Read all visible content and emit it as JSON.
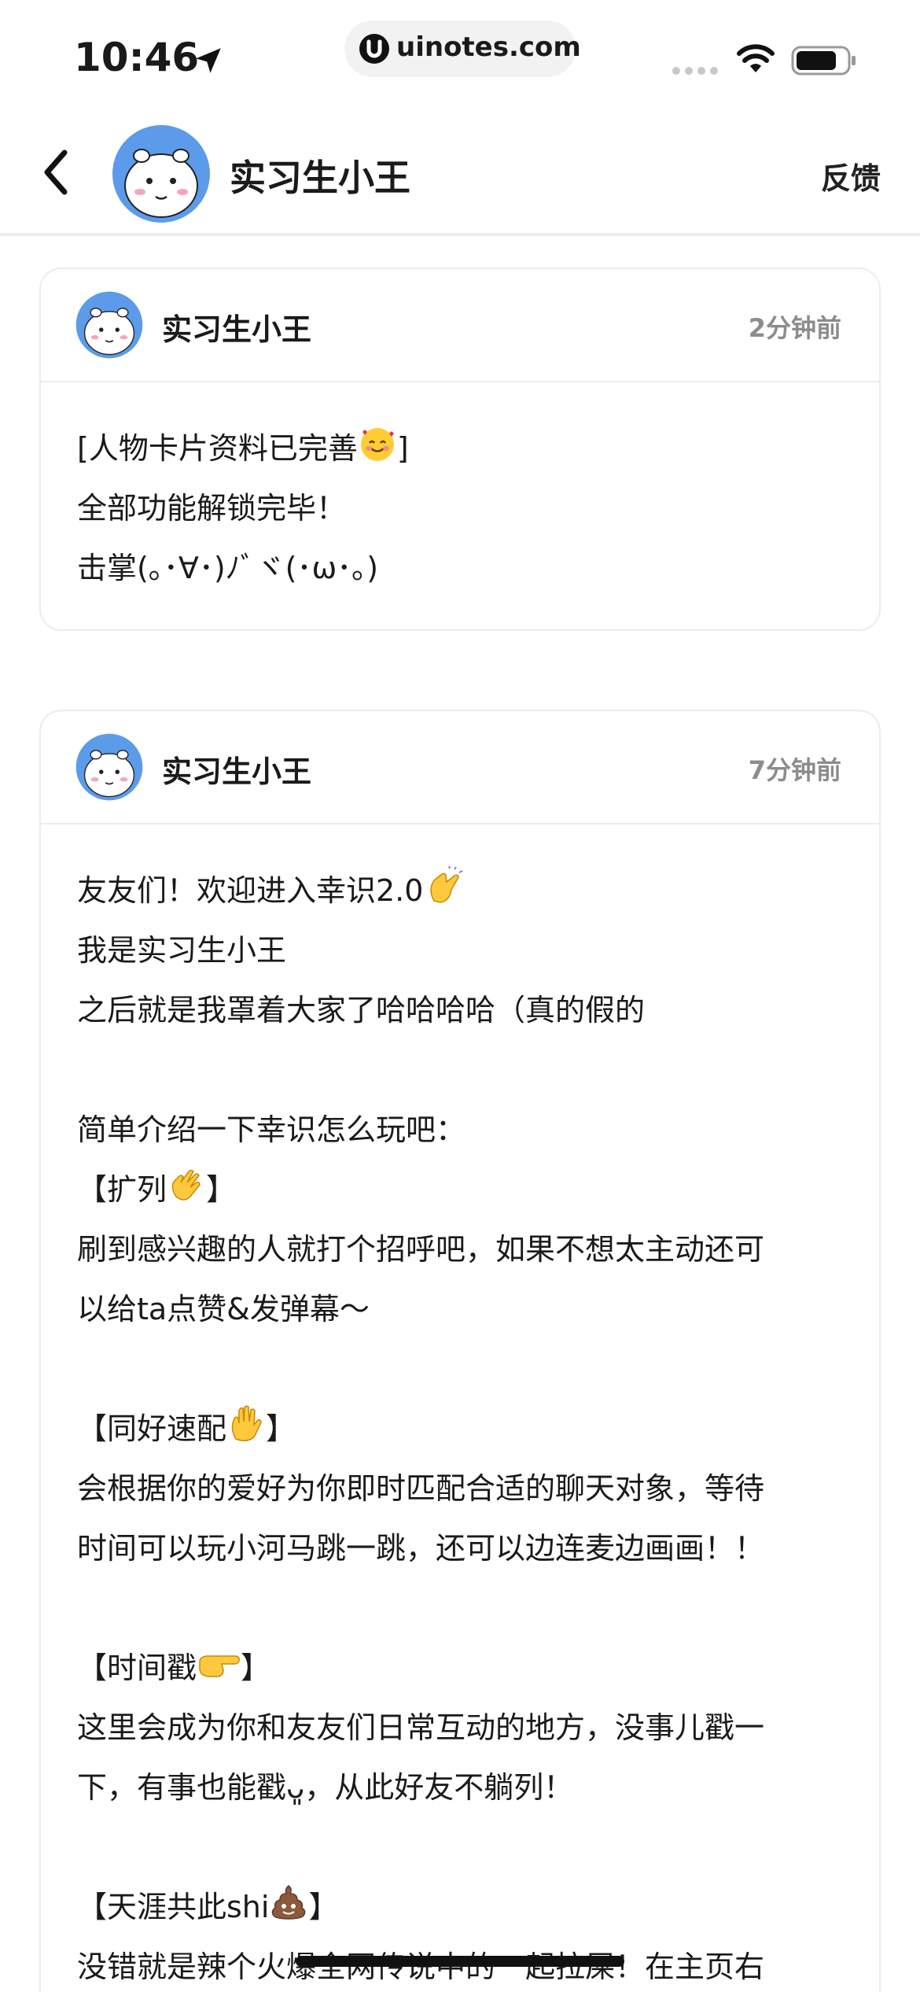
{
  "status_bar": {
    "time": "10:46",
    "url": "uinotes.com"
  },
  "nav": {
    "title": "实习生小王",
    "feedback": "反馈"
  },
  "messages": [
    {
      "sender": "实习生小王",
      "time": "2分钟前",
      "lines": {
        "l0": "[人物卡片资料已完善",
        "l0_end": "]",
        "l1": "全部功能解锁完毕！",
        "l2": "击掌(｡･∀･)ﾉﾞヾ(･ω･｡)"
      }
    },
    {
      "sender": "实习生小王",
      "time": "7分钟前",
      "lines": {
        "l0": "友友们！欢迎进入幸识2.0",
        "l1": "我是实习生小王",
        "l2": "之后就是我罩着大家了哈哈哈哈（真的假的",
        "l4": "简单介绍一下幸识怎么玩吧：",
        "l5": "【扩列",
        "l5_end": "】",
        "l6": "刷到感兴趣的人就打个招呼吧，如果不想太主动还可",
        "l7": "以给ta点赞&发弹幕～",
        "l9": "【同好速配",
        "l9_end": "】",
        "l10": "会根据你的爱好为你即时匹配合适的聊天对象，等待",
        "l11": "时间可以玩小河马跳一跳，还可以边连麦边画画！！",
        "l13": "【时间戳",
        "l13_end": "】",
        "l14": "这里会成为你和友友们日常互动的地方，没事儿戳一",
        "l15": "下，有事也能戳ᴗ͈，从此好友不躺列！",
        "l17": "【天涯共此shi",
        "l17_end": "】",
        "l18": "没错就是辣个火爆全网传说中的一起拉屎！在主页右"
      }
    }
  ],
  "icons": {
    "back": "chevron-left-icon",
    "location": "location-arrow-icon",
    "wifi": "wifi-icon",
    "battery": "battery-icon",
    "emoji_smiling_hearts": "smiling-face-with-hearts-emoji",
    "emoji_clap": "clapping-hands-emoji",
    "emoji_wave": "waving-hand-emoji",
    "emoji_raised_hand": "raised-hand-emoji",
    "emoji_point_right": "backhand-index-pointing-right-emoji",
    "emoji_poop": "pile-of-poo-emoji"
  },
  "colors": {
    "avatar_bg": "#5b9bea",
    "time_text": "#8c8c8c",
    "divider": "#ededed"
  }
}
